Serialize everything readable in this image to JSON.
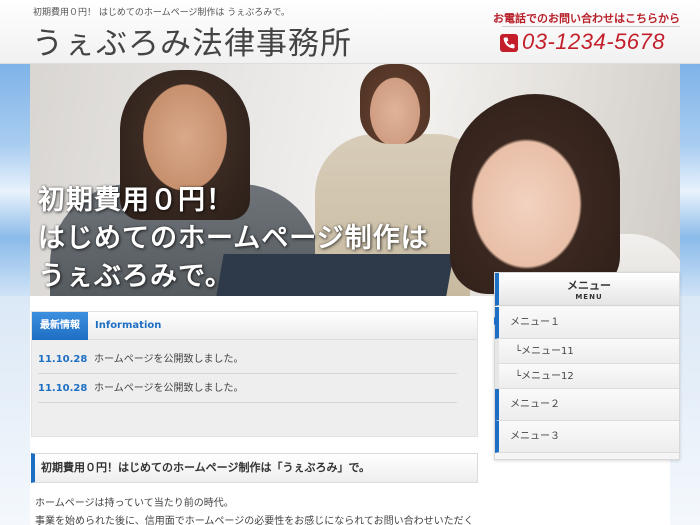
{
  "header": {
    "tagline": "初期費用０円！ はじめてのホームページ制作は うぇぶろみで。",
    "site_title": "うぇぶろみ法律事務所",
    "contact_label": "お電話でのお問い合わせはこちらから",
    "phone": "03-1234-5678",
    "phone_icon": "phone-icon"
  },
  "hero": {
    "lines": [
      "初期費用０円！",
      "はじめてのホームページ制作は",
      "うぇぶろみで。"
    ]
  },
  "news": {
    "badge": "最新情報",
    "label": "Information",
    "items": [
      {
        "date": "11.10.28",
        "text": "ホームページを公開致しました。"
      },
      {
        "date": "11.10.28",
        "text": "ホームページを公開致しました。"
      }
    ]
  },
  "intro": {
    "heading": "初期費用０円！はじめてのホームページ制作は「うぇぶろみ」で。",
    "p1": "ホームページは持っていて当たり前の時代。",
    "p2": "事業を始められた後に、信用面でホームページの必要性をお感じになられてお問い合わせいただく"
  },
  "menu": {
    "title": "メニュー",
    "subtitle": "MENU",
    "items": [
      "メニュー１",
      "└メニュー11",
      "└メニュー12",
      "メニュー２",
      "メニュー３"
    ]
  },
  "colors": {
    "accent": "#1e6fc4",
    "phone_red": "#c41e2a"
  }
}
